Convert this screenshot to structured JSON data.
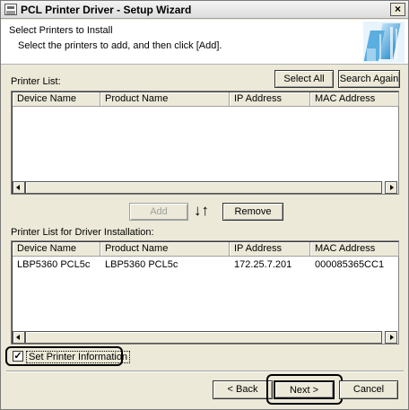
{
  "window": {
    "title": "PCL Printer Driver - Setup Wizard",
    "close_label": "×"
  },
  "header": {
    "title": "Select Printers to Install",
    "subtitle": "Select the printers to add, and then click [Add]."
  },
  "printer_list": {
    "label": "Printer List:",
    "columns": [
      "Device Name",
      "Product Name",
      "IP Address",
      "MAC Address"
    ],
    "rows": []
  },
  "toolbar": {
    "select_all_label": "Select All",
    "search_again_label": "Search Again"
  },
  "middle": {
    "add_label": "Add",
    "arrows_label": "↓↑",
    "remove_label": "Remove"
  },
  "install_list": {
    "label": "Printer List for Driver Installation:",
    "columns": [
      "Device Name",
      "Product Name",
      "IP Address",
      "MAC Address"
    ],
    "rows": [
      [
        "LBP5360 PCL5c",
        "LBP5360 PCL5c",
        "172.25.7.201",
        "000085365CC1"
      ]
    ]
  },
  "options": {
    "set_printer_info_label": "Set Printer Information",
    "set_printer_info_checked": true,
    "check_mark": "✓"
  },
  "footer": {
    "back_label": "< Back",
    "next_label": "Next >",
    "cancel_label": "Cancel"
  }
}
